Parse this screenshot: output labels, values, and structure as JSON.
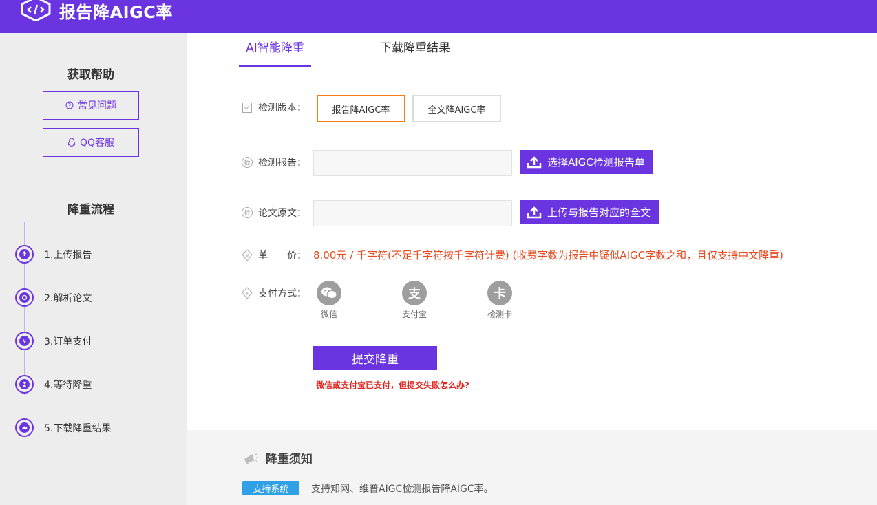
{
  "header": {
    "logo_text": "报告降AIGC率"
  },
  "sidebar": {
    "help_title": "获取帮助",
    "faq_label": "常见问题",
    "qq_label": "QQ客服",
    "process_title": "降重流程",
    "steps": [
      {
        "label": "1.上传报告",
        "icon": "upload-icon"
      },
      {
        "label": "2.解析论文",
        "icon": "analyze-icon"
      },
      {
        "label": "3.订单支付",
        "icon": "payment-icon"
      },
      {
        "label": "4.等待降重",
        "icon": "hourglass-icon"
      },
      {
        "label": "5.下载降重结果",
        "icon": "cloud-download-icon"
      }
    ]
  },
  "tabs": [
    {
      "label": "AI智能降重",
      "active": true
    },
    {
      "label": "下载降重结果",
      "active": false
    }
  ],
  "form": {
    "version_label": "检测版本：",
    "version_options": [
      "报告降AIGC率",
      "全文降AIGC率"
    ],
    "report_label": "检测报告：",
    "report_button": "选择AIGC检测报告单",
    "paper_label": "论文原文：",
    "paper_button": "上传与报告对应的全文",
    "price_label_1": "单",
    "price_label_2": "价：",
    "price_text": "8.00元 / 千字符(不足千字符按千字符计费) (收费字数为报告中疑似AIGC字数之和，且仅支持中文降重)",
    "payment_label": "支付方式：",
    "payment_methods": [
      {
        "label": "微信",
        "icon": "wechat-icon"
      },
      {
        "label": "支付宝",
        "icon": "alipay-icon"
      },
      {
        "label": "检测卡",
        "icon": "card-icon"
      }
    ],
    "submit_label": "提交降重",
    "fail_link": "微信或支付宝已支付，但提交失败怎么办?"
  },
  "notice": {
    "title": "降重须知",
    "badge": "支持系统",
    "text": "支持知网、维普AIGC检测报告降AIGC率。"
  },
  "colors": {
    "brand": "#6a35e0",
    "accent_orange": "#f07f1a",
    "price_red": "#e8491d",
    "badge_blue": "#2f9fe6"
  }
}
